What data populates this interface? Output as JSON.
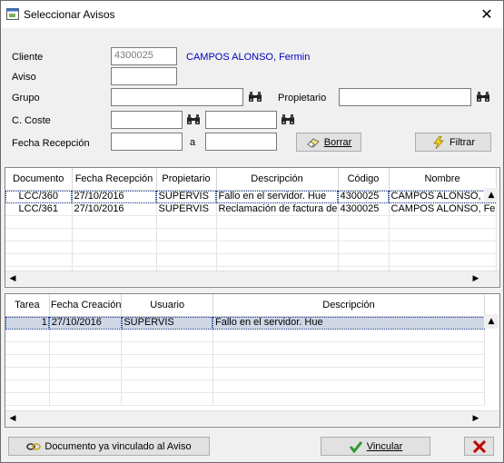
{
  "window": {
    "title": "Seleccionar Avisos",
    "close_glyph": "✕"
  },
  "form": {
    "cliente_label": "Cliente",
    "cliente_code": "4300025",
    "cliente_name": "CAMPOS ALONSO, Fermin",
    "aviso_label": "Aviso",
    "grupo_label": "Grupo",
    "propietario_label": "Propietario",
    "coste_label": "C. Coste",
    "fecha_label": "Fecha Recepción",
    "a_label": "a",
    "borrar_label": "Borrar",
    "filtrar_label": "Filtrar"
  },
  "avisos": {
    "columns": [
      "Documento",
      "Fecha Recepción",
      "Propietario",
      "Descripción",
      "Código",
      "Nombre"
    ],
    "rows": [
      [
        "LCC/360",
        "27/10/2016",
        "SUPERVIS",
        "Fallo en el servidor. Hue",
        "4300025",
        "CAMPOS ALONSO, Fe"
      ],
      [
        "LCC/361",
        "27/10/2016",
        "SUPERVIS",
        "Reclamación de factura de",
        "4300025",
        "CAMPOS ALONSO, Fe"
      ]
    ]
  },
  "tareas": {
    "columns": [
      "Tarea",
      "Fecha Creación",
      "Usuario",
      "Descripción"
    ],
    "rows": [
      [
        "1",
        "27/10/2016",
        "SUPERVIS",
        "Fallo en el servidor. Hue"
      ]
    ]
  },
  "footer": {
    "vinculado_label": "Documento ya vinculado al Aviso",
    "vincular_label": "Vincular"
  },
  "colors": {
    "link_blue": "#0000c0",
    "selected_row": "#cfd7e6",
    "close_red": "#c00000",
    "check_green": "#2e9a2e"
  }
}
